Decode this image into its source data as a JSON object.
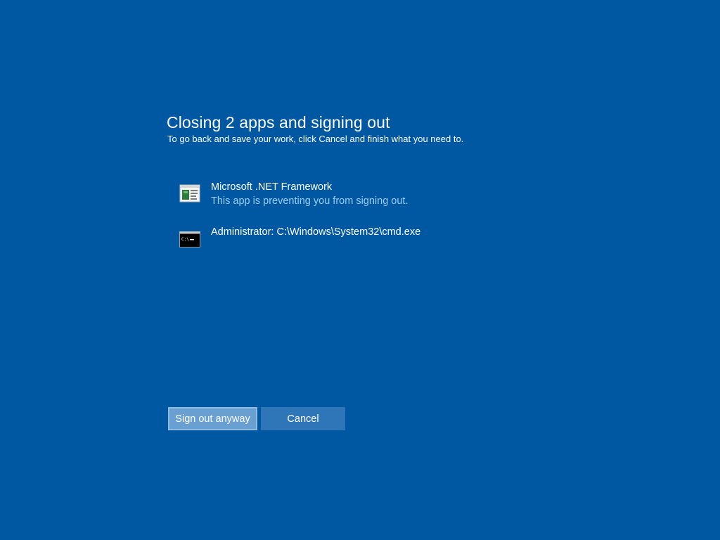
{
  "dialog": {
    "title": "Closing 2 apps and signing out",
    "subtitle": "To go back and save your work, click Cancel and finish what you need to."
  },
  "apps": [
    {
      "name": "Microsoft .NET Framework",
      "status": "This app is preventing you from signing out.",
      "icon": "dotnet-app-icon"
    },
    {
      "name": "Administrator: C:\\Windows\\System32\\cmd.exe",
      "status": "",
      "icon": "cmd-icon"
    }
  ],
  "buttons": {
    "sign_out_label": "Sign out anyway",
    "cancel_label": "Cancel"
  },
  "colors": {
    "background": "#0058a3",
    "status_text": "#9dcdf3",
    "primary_button": "#6aa0d1",
    "secondary_button": "#2f76b8"
  }
}
